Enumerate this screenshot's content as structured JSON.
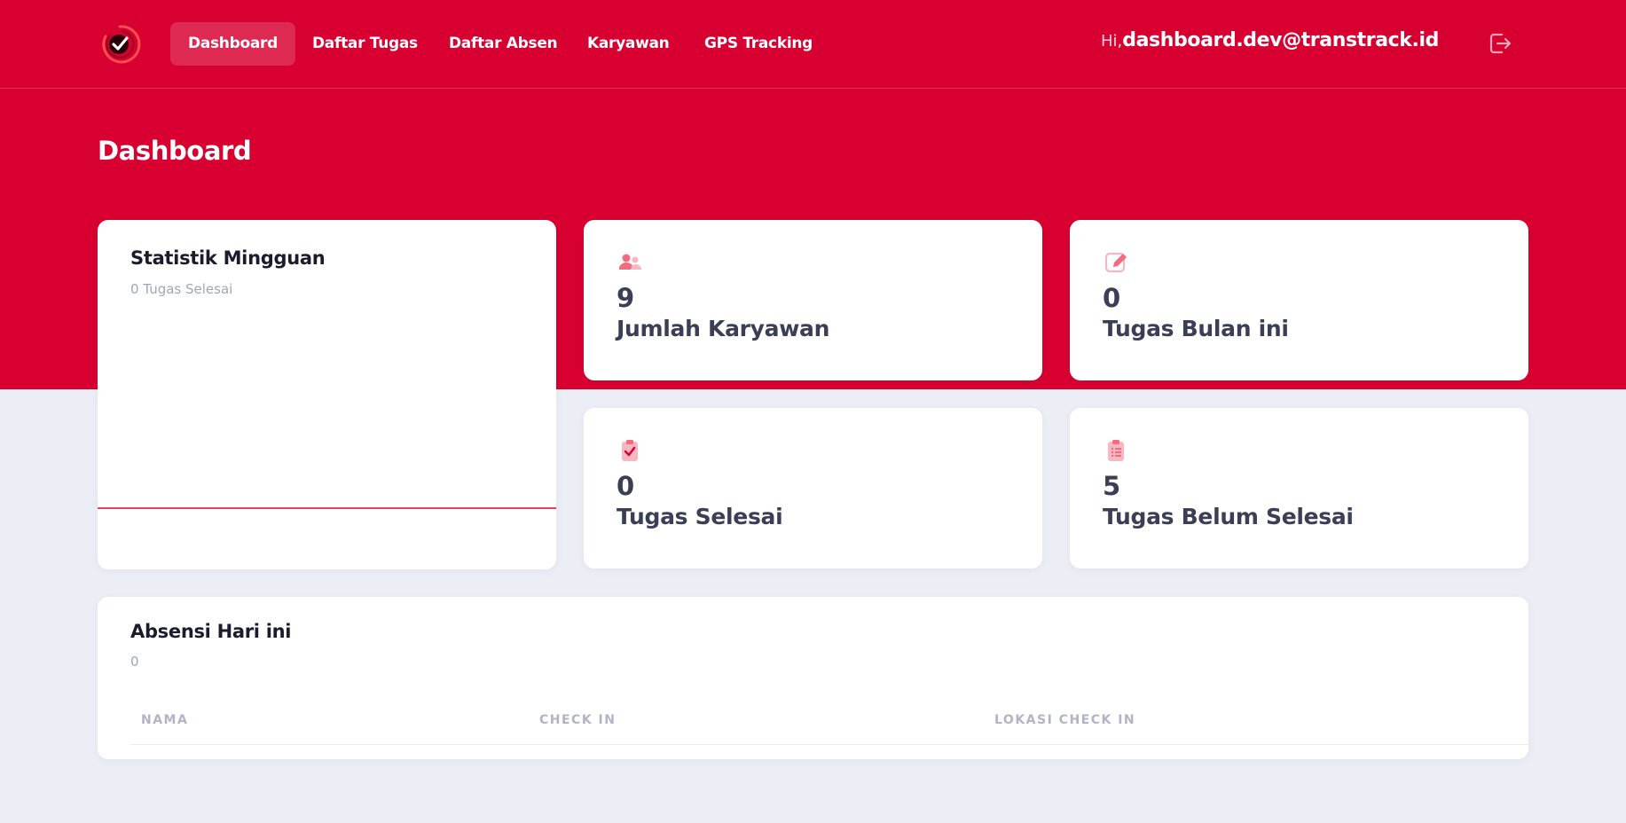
{
  "nav": {
    "items": [
      {
        "label": "Dashboard",
        "active": true
      },
      {
        "label": "Daftar Tugas",
        "active": false
      },
      {
        "label": "Daftar Absen",
        "active": false
      },
      {
        "label": "Karyawan",
        "active": false
      },
      {
        "label": "GPS Tracking",
        "active": false
      }
    ],
    "greeting": "Hi,",
    "user_email": "dashboard.dev@transtrack.id",
    "logout_icon": "logout-icon"
  },
  "page": {
    "title": "Dashboard"
  },
  "weekly": {
    "title": "Statistik Mingguan",
    "subtitle": "0 Tugas Selesai"
  },
  "stats": [
    {
      "icon": "users-icon",
      "value": "9",
      "label": "Jumlah Karyawan"
    },
    {
      "icon": "edit-icon",
      "value": "0",
      "label": "Tugas Bulan ini"
    },
    {
      "icon": "clipboard-check-icon",
      "value": "0",
      "label": "Tugas Selesai"
    },
    {
      "icon": "clipboard-list-icon",
      "value": "5",
      "label": "Tugas Belum Selesai"
    }
  ],
  "attendance": {
    "title": "Absensi Hari ini",
    "count": "0",
    "columns": [
      "Nama",
      "Check In",
      "Lokasi Check In"
    ]
  },
  "colors": {
    "brand_red": "#d80031",
    "background": "#eceef6",
    "icon_pink": "#f26b7f"
  }
}
